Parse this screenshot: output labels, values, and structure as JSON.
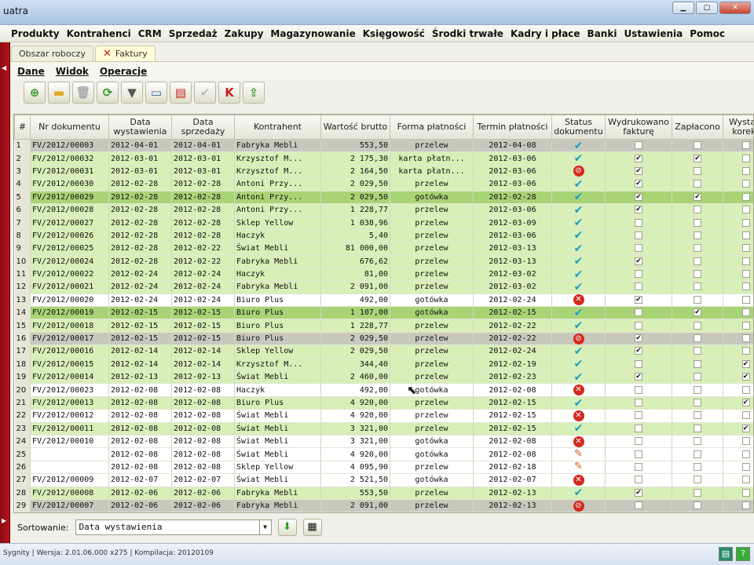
{
  "window": {
    "title": "uatra"
  },
  "menu": [
    "Produkty",
    "Kontrahenci",
    "CRM",
    "Sprzedaż",
    "Zakupy",
    "Magazynowanie",
    "Księgowość",
    "Środki trwałe",
    "Kadry i płace",
    "Banki",
    "Ustawienia",
    "Pomoc"
  ],
  "tabs": {
    "workspace": "Obszar roboczy",
    "invoices": "Faktury"
  },
  "submenu": [
    "Dane",
    "Widok",
    "Operacje"
  ],
  "toolbar_icons": [
    "add-icon",
    "folder-icon",
    "delete-icon",
    "refresh-icon",
    "filter-icon",
    "print-icon",
    "cash-register-icon",
    "check-icon",
    "correction-icon",
    "export-icon"
  ],
  "columns": [
    "#",
    "Nr dokumentu",
    "Data wystawienia",
    "Data sprzedaży",
    "Kontrahent",
    "Wartość brutto",
    "Forma płatności",
    "Termin płatności",
    "Status dokumentu",
    "Wydrukowano fakturę",
    "Zapłacono",
    "Wystaw korekt"
  ],
  "rows": [
    {
      "n": "1",
      "doc": "FV/2012/00003",
      "issued": "2012-04-01",
      "sale": "2012-04-01",
      "client": "Fabryka Mebli",
      "gross": "553,50",
      "pay": "przelew",
      "due": "2012-04-08",
      "status": "ok",
      "printed": "",
      "paid": "",
      "corr": ""
    },
    {
      "n": "2",
      "doc": "FV/2012/00032",
      "issued": "2012-03-01",
      "sale": "2012-03-01",
      "client": "Krzysztof M...",
      "gross": "2 175,30",
      "pay": "karta płatn...",
      "due": "2012-03-06",
      "status": "ok",
      "printed": "✔",
      "paid": "✔",
      "corr": ""
    },
    {
      "n": "3",
      "doc": "FV/2012/00031",
      "issued": "2012-03-01",
      "sale": "2012-03-01",
      "client": "Krzysztof M...",
      "gross": "2 164,50",
      "pay": "karta płatn...",
      "due": "2012-03-06",
      "status": "ban",
      "printed": "✔",
      "paid": "",
      "corr": ""
    },
    {
      "n": "4",
      "doc": "FV/2012/00030",
      "issued": "2012-02-28",
      "sale": "2012-02-28",
      "client": "Antoni Przy...",
      "gross": "2 029,50",
      "pay": "przelew",
      "due": "2012-03-06",
      "status": "ok",
      "printed": "✔",
      "paid": "",
      "corr": ""
    },
    {
      "n": "5",
      "doc": "FV/2012/00029",
      "issued": "2012-02-28",
      "sale": "2012-02-28",
      "client": "Antoni Przy...",
      "gross": "2 029,50",
      "pay": "gotówka",
      "due": "2012-02-28",
      "status": "ok",
      "printed": "✔",
      "paid": "✔",
      "corr": ""
    },
    {
      "n": "6",
      "doc": "FV/2012/00028",
      "issued": "2012-02-28",
      "sale": "2012-02-28",
      "client": "Antoni Przy...",
      "gross": "1 228,77",
      "pay": "przelew",
      "due": "2012-03-06",
      "status": "ok",
      "printed": "✔",
      "paid": "",
      "corr": ""
    },
    {
      "n": "7",
      "doc": "FV/2012/00027",
      "issued": "2012-02-28",
      "sale": "2012-02-28",
      "client": "Sklep Yellow",
      "gross": "1 038,96",
      "pay": "przelew",
      "due": "2012-03-09",
      "status": "ok",
      "printed": "",
      "paid": "",
      "corr": ""
    },
    {
      "n": "8",
      "doc": "FV/2012/00026",
      "issued": "2012-02-28",
      "sale": "2012-02-28",
      "client": "Haczyk",
      "gross": "5,40",
      "pay": "przelew",
      "due": "2012-03-06",
      "status": "ok",
      "printed": "",
      "paid": "",
      "corr": ""
    },
    {
      "n": "9",
      "doc": "FV/2012/00025",
      "issued": "2012-02-28",
      "sale": "2012-02-22",
      "client": "Świat Mebli",
      "gross": "81 000,00",
      "pay": "przelew",
      "due": "2012-03-13",
      "status": "ok",
      "printed": "",
      "paid": "",
      "corr": ""
    },
    {
      "n": "10",
      "doc": "FV/2012/00024",
      "issued": "2012-02-28",
      "sale": "2012-02-22",
      "client": "Fabryka Mebli",
      "gross": "676,62",
      "pay": "przelew",
      "due": "2012-03-13",
      "status": "ok",
      "printed": "✔",
      "paid": "",
      "corr": ""
    },
    {
      "n": "11",
      "doc": "FV/2012/00022",
      "issued": "2012-02-24",
      "sale": "2012-02-24",
      "client": "Haczyk",
      "gross": "81,00",
      "pay": "przelew",
      "due": "2012-03-02",
      "status": "ok",
      "printed": "",
      "paid": "",
      "corr": ""
    },
    {
      "n": "12",
      "doc": "FV/2012/00021",
      "issued": "2012-02-24",
      "sale": "2012-02-24",
      "client": "Fabryka Mebli",
      "gross": "2 091,00",
      "pay": "przelew",
      "due": "2012-03-02",
      "status": "ok",
      "printed": "",
      "paid": "",
      "corr": ""
    },
    {
      "n": "13",
      "doc": "FV/2012/00020",
      "issued": "2012-02-24",
      "sale": "2012-02-24",
      "client": "Biuro Plus",
      "gross": "492,00",
      "pay": "gotówka",
      "due": "2012-02-24",
      "status": "no",
      "printed": "✔",
      "paid": "",
      "corr": ""
    },
    {
      "n": "14",
      "doc": "FV/2012/00019",
      "issued": "2012-02-15",
      "sale": "2012-02-15",
      "client": "Biuro Plus",
      "gross": "1 107,00",
      "pay": "gotówka",
      "due": "2012-02-15",
      "status": "ok",
      "printed": "",
      "paid": "✔",
      "corr": ""
    },
    {
      "n": "15",
      "doc": "FV/2012/00018",
      "issued": "2012-02-15",
      "sale": "2012-02-15",
      "client": "Biuro Plus",
      "gross": "1 228,77",
      "pay": "przelew",
      "due": "2012-02-22",
      "status": "ok",
      "printed": "",
      "paid": "",
      "corr": ""
    },
    {
      "n": "16",
      "doc": "FV/2012/00017",
      "issued": "2012-02-15",
      "sale": "2012-02-15",
      "client": "Biuro Plus",
      "gross": "2 029,50",
      "pay": "przelew",
      "due": "2012-02-22",
      "status": "ban",
      "printed": "✔",
      "paid": "",
      "corr": ""
    },
    {
      "n": "17",
      "doc": "FV/2012/00016",
      "issued": "2012-02-14",
      "sale": "2012-02-14",
      "client": "Sklep Yellow",
      "gross": "2 029,50",
      "pay": "przelew",
      "due": "2012-02-24",
      "status": "ok",
      "printed": "✔",
      "paid": "",
      "corr": ""
    },
    {
      "n": "18",
      "doc": "FV/2012/00015",
      "issued": "2012-02-14",
      "sale": "2012-02-14",
      "client": "Krzysztof M...",
      "gross": "344,40",
      "pay": "przelew",
      "due": "2012-02-19",
      "status": "ok",
      "printed": "",
      "paid": "",
      "corr": "✔"
    },
    {
      "n": "19",
      "doc": "FV/2012/00014",
      "issued": "2012-02-13",
      "sale": "2012-02-13",
      "client": "Świat Mebli",
      "gross": "2 460,00",
      "pay": "przelew",
      "due": "2012-02-23",
      "status": "ok",
      "printed": "✔",
      "paid": "",
      "corr": "✔"
    },
    {
      "n": "20",
      "doc": "FV/2012/00023",
      "issued": "2012-02-08",
      "sale": "2012-02-08",
      "client": "Haczyk",
      "gross": "492,00",
      "pay": "gotówka",
      "due": "2012-02-08",
      "status": "no",
      "printed": "",
      "paid": "",
      "corr": ""
    },
    {
      "n": "21",
      "doc": "FV/2012/00013",
      "issued": "2012-02-08",
      "sale": "2012-02-08",
      "client": "Biuro Plus",
      "gross": "4 920,00",
      "pay": "przelew",
      "due": "2012-02-15",
      "status": "ok",
      "printed": "",
      "paid": "",
      "corr": "✔"
    },
    {
      "n": "22",
      "doc": "FV/2012/00012",
      "issued": "2012-02-08",
      "sale": "2012-02-08",
      "client": "Świat Mebli",
      "gross": "4 920,00",
      "pay": "przelew",
      "due": "2012-02-15",
      "status": "no",
      "printed": "",
      "paid": "",
      "corr": ""
    },
    {
      "n": "23",
      "doc": "FV/2012/00011",
      "issued": "2012-02-08",
      "sale": "2012-02-08",
      "client": "Świat Mebli",
      "gross": "3 321,00",
      "pay": "przelew",
      "due": "2012-02-15",
      "status": "ok",
      "printed": "",
      "paid": "",
      "corr": "✔"
    },
    {
      "n": "24",
      "doc": "FV/2012/00010",
      "issued": "2012-02-08",
      "sale": "2012-02-08",
      "client": "Świat Mebli",
      "gross": "3 321,00",
      "pay": "gotówka",
      "due": "2012-02-08",
      "status": "no",
      "printed": "",
      "paid": "",
      "corr": ""
    },
    {
      "n": "25",
      "doc": "",
      "issued": "2012-02-08",
      "sale": "2012-02-08",
      "client": "Świat Mebli",
      "gross": "4 920,00",
      "pay": "gotówka",
      "due": "2012-02-08",
      "status": "pen",
      "printed": "",
      "paid": "",
      "corr": ""
    },
    {
      "n": "26",
      "doc": "",
      "issued": "2012-02-08",
      "sale": "2012-02-08",
      "client": "Sklep Yellow",
      "gross": "4 095,90",
      "pay": "przelew",
      "due": "2012-02-18",
      "status": "pen",
      "printed": "",
      "paid": "",
      "corr": ""
    },
    {
      "n": "27",
      "doc": "FV/2012/00009",
      "issued": "2012-02-07",
      "sale": "2012-02-07",
      "client": "Świat Mebli",
      "gross": "2 521,50",
      "pay": "gotówka",
      "due": "2012-02-07",
      "status": "no",
      "printed": "",
      "paid": "",
      "corr": ""
    },
    {
      "n": "28",
      "doc": "FV/2012/00008",
      "issued": "2012-02-06",
      "sale": "2012-02-06",
      "client": "Fabryka Mebli",
      "gross": "553,50",
      "pay": "przelew",
      "due": "2012-02-13",
      "status": "ok",
      "printed": "✔",
      "paid": "",
      "corr": ""
    },
    {
      "n": "29",
      "doc": "FV/2012/00007",
      "issued": "2012-02-06",
      "sale": "2012-02-06",
      "client": "Fabryka Mebli",
      "gross": "2 091,00",
      "pay": "przelew",
      "due": "2012-02-13",
      "status": "ban",
      "printed": "",
      "paid": "",
      "corr": ""
    }
  ],
  "row_styles": [
    "y",
    "g",
    "g",
    "g",
    "s",
    "g",
    "g",
    "g",
    "g",
    "g",
    "g",
    "g",
    "w",
    "s",
    "g",
    "y",
    "g",
    "g",
    "g",
    "w",
    "g",
    "w",
    "g",
    "w",
    "w",
    "w",
    "w",
    "g",
    "y"
  ],
  "sort": {
    "label": "Sortowanie:",
    "value": "Data wystawienia"
  },
  "status_text": "Sygnity | Wersja: 2.01.06.000 x275 | Kompilacja: 20120109"
}
